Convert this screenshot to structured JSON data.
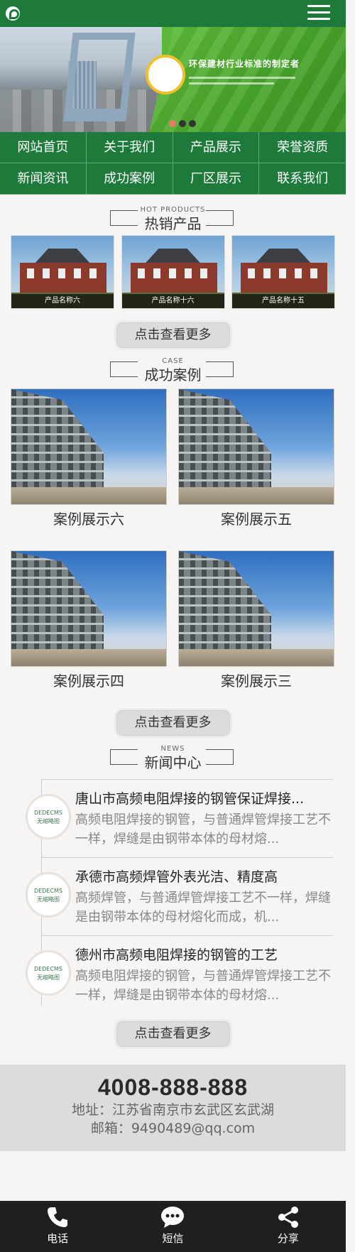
{
  "banner": {
    "slogan": "环保建材行业标准的制定者"
  },
  "nav": [
    "网站首页",
    "关于我们",
    "产品展示",
    "荣誉资质",
    "新闻资讯",
    "成功案例",
    "厂区展示",
    "联系我们"
  ],
  "hot_products": {
    "en": "HOT PRODUCTS",
    "cn": "热销产品",
    "items": [
      "产品名称六",
      "产品名称十六",
      "产品名称十五"
    ],
    "more": "点击查看更多"
  },
  "cases": {
    "en": "CASE",
    "cn": "成功案例",
    "items": [
      "案例展示六",
      "案例展示五",
      "案例展示四",
      "案例展示三"
    ],
    "more": "点击查看更多"
  },
  "news": {
    "en": "NEWS",
    "cn": "新闻中心",
    "thumb_text": [
      "DEDECMS",
      "无缩略图"
    ],
    "items": [
      {
        "title": "唐山市高频电阻焊接的钢管保证焊接...",
        "desc": "高频电阻焊接的钢管，与普通焊管焊接工艺不一样，焊缝是由钢带本体的母材熔..."
      },
      {
        "title": "承德市高频焊管外表光洁、精度高",
        "desc": "高频焊管，与普通焊管焊接工艺不一样，焊缝是由钢带本体的母材熔化而成，机..."
      },
      {
        "title": "德州市高频电阻焊接的钢管的工艺",
        "desc": "高频电阻焊接的钢管，与普通焊管焊接工艺不一样，焊缝是由钢带本体的母材熔..."
      }
    ],
    "more": "点击查看更多"
  },
  "contact": {
    "phone": "4008-888-888",
    "address": "地址：江苏省南京市玄武区玄武湖",
    "email": "邮箱：9490489@qq.com"
  },
  "bottombar": {
    "items": [
      {
        "label": "电话",
        "icon": "phone-icon"
      },
      {
        "label": "短信",
        "icon": "sms-icon"
      },
      {
        "label": "分享",
        "icon": "share-icon"
      }
    ]
  },
  "colors": {
    "brand_green": "#1d7a3a",
    "bottom_bar": "#1f1f1f",
    "contact_bg": "#dcdcdc"
  }
}
